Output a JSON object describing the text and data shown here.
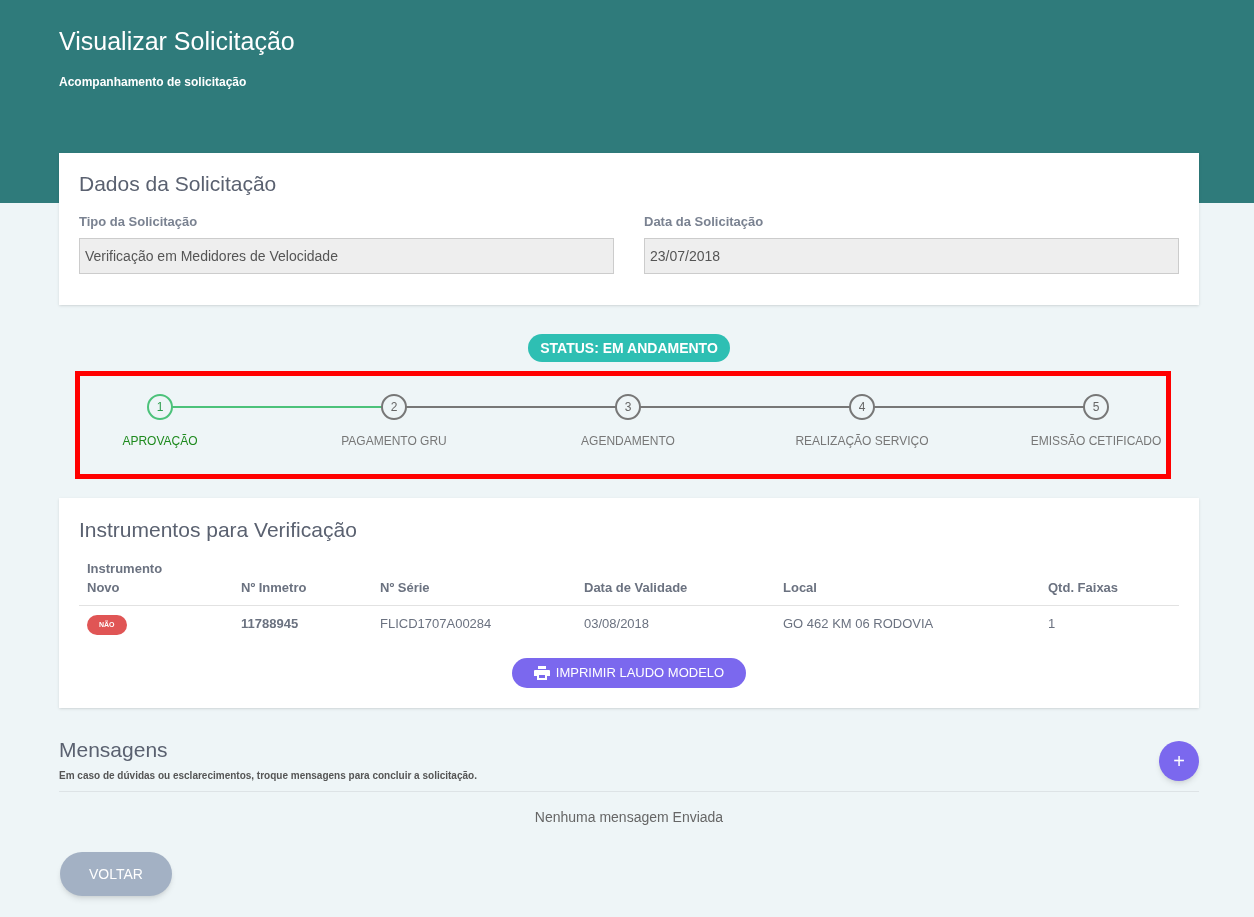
{
  "header": {
    "title": "Visualizar Solicitação",
    "subtitle": "Acompanhamento de solicitação"
  },
  "request_card": {
    "title": "Dados da Solicitação",
    "fields": [
      {
        "label": "Tipo da Solicitação",
        "value": "Verificação em Medidores de Velocidade"
      },
      {
        "label": "Data da Solicitação",
        "value": "23/07/2018"
      }
    ]
  },
  "status": "STATUS: EM ANDAMENTO",
  "steps": [
    {
      "number": "1",
      "label": "APROVAÇÃO",
      "active": true
    },
    {
      "number": "2",
      "label": "PAGAMENTO GRU",
      "active": false
    },
    {
      "number": "3",
      "label": "AGENDAMENTO",
      "active": false
    },
    {
      "number": "4",
      "label": "REALIZAÇÃO SERVIÇO",
      "active": false
    },
    {
      "number": "5",
      "label": "EMISSÃO CETIFICADO",
      "active": false
    }
  ],
  "instruments": {
    "title": "Instrumentos para Verificação",
    "columns": [
      "Instrumento Novo",
      "Nº Inmetro",
      "Nº Série",
      "Data de Validade",
      "Local",
      "Qtd. Faixas"
    ],
    "rows": [
      {
        "new": "NÃO",
        "inmetro": "11788945",
        "serie": "FLICD1707A00284",
        "validade": "03/08/2018",
        "local": "GO 462 KM 06 RODOVIA",
        "faixas": "1"
      }
    ],
    "print_button": "IMPRIMIR LAUDO MODELO"
  },
  "messages": {
    "title": "Mensagens",
    "hint": "Em caso de dúvidas ou esclarecimentos, troque mensagens para concluir a solicitação.",
    "add_button": "+",
    "empty": "Nenhuma mensagem Enviada"
  },
  "back_button": "VOLTAR"
}
